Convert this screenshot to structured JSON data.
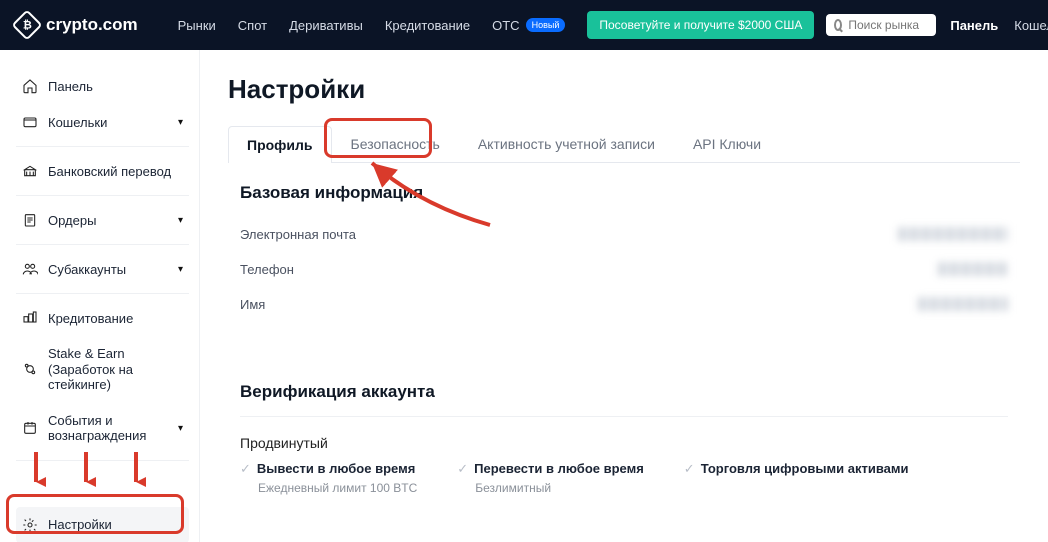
{
  "brand": "crypto.com",
  "topnav": {
    "links": [
      "Рынки",
      "Спот",
      "Деривативы",
      "Кредитование",
      "OTC"
    ],
    "otc_badge": "Новый",
    "ref_button": "Посоветуйте и получите $2000 США",
    "search_placeholder": "Поиск рынка",
    "panel_label": "Панель",
    "wallets_label": "Кошельк"
  },
  "sidebar": {
    "items": [
      {
        "label": "Панель",
        "icon": "home-icon"
      },
      {
        "label": "Кошельки",
        "icon": "wallet-icon",
        "expandable": true
      },
      {
        "label": "Банковский перевод",
        "icon": "bank-icon"
      },
      {
        "label": "Ордеры",
        "icon": "orders-icon",
        "expandable": true
      },
      {
        "label": "Субаккаунты",
        "icon": "subaccounts-icon",
        "expandable": true
      },
      {
        "label": "Кредитование",
        "icon": "lending-icon"
      },
      {
        "label": "Stake & Earn (Заработок на стейкинге)",
        "icon": "stake-icon"
      },
      {
        "label": "События и вознаграждения",
        "icon": "rewards-icon",
        "expandable": true
      },
      {
        "label": "Настройки",
        "icon": "settings-icon"
      }
    ]
  },
  "page": {
    "title": "Настройки",
    "tabs": [
      "Профиль",
      "Безопасность",
      "Активность учетной записи",
      "API Ключи"
    ],
    "active_tab": 0,
    "basic_section": "Базовая информация",
    "fields": {
      "email": "Электронная почта",
      "phone": "Телефон",
      "name": "Имя"
    },
    "verification_section": "Верификация аккаунта",
    "verification_level": "Продвинутый",
    "features": [
      {
        "title": "Вывести в любое время",
        "sub": "Ежедневный лимит 100 BTC"
      },
      {
        "title": "Перевести в любое время",
        "sub": "Безлимитный"
      },
      {
        "title": "Торговля цифровыми активами",
        "sub": ""
      }
    ]
  },
  "annotation": {
    "highlight_security_tab": true,
    "highlight_settings_sidebar": true
  }
}
